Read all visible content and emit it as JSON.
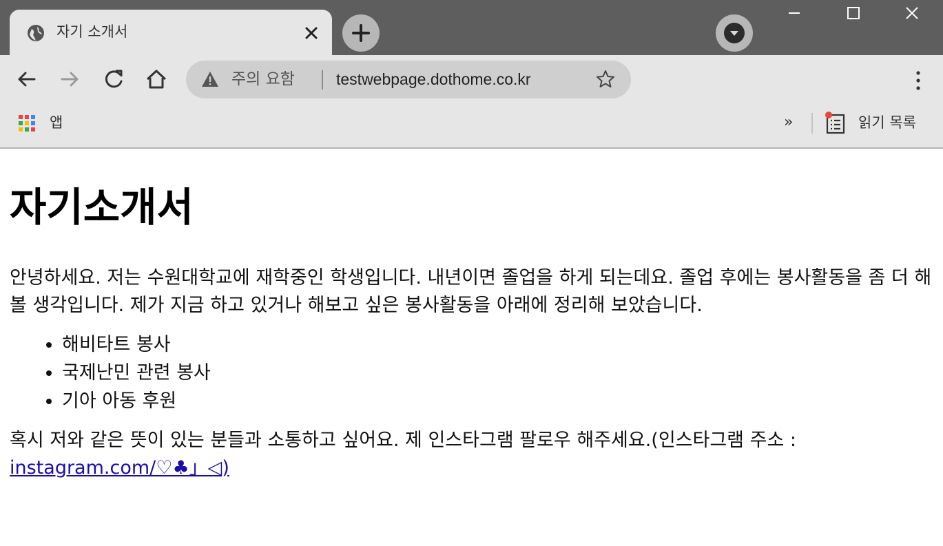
{
  "browser": {
    "tab": {
      "title": "자기 소개서",
      "icon": "globe-icon"
    },
    "omnibox": {
      "security_label": "주의 요함",
      "url": "testwebpage.dothome.co.kr"
    },
    "bookmarks": {
      "apps_label": "앱",
      "overflow_label": "»",
      "reading_list_label": "읽기 목록"
    }
  },
  "page": {
    "heading": "자기소개서",
    "intro": "안녕하세요. 저는 수원대학교에 재학중인 학생입니다. 내년이면 졸업을 하게 되는데요. 졸업 후에는 봉사활동을 좀 더 해볼 생각입니다. 제가 지금 하고 있거나 해보고 싶은 봉사활동을 아래에 정리해 보았습니다.",
    "activities": [
      "해비타트 봉사",
      "국제난민 관련 봉사",
      "기아 아동 후원"
    ],
    "closing": "혹시 저와 같은 뜻이 있는 분들과 소통하고 싶어요. 제 인스타그램 팔로우 해주세요.(인스타그램 주소 : ",
    "link_text": "instagram.com/♡♣」◁)"
  },
  "colors": {
    "titlebar": "#5e5e5e",
    "toolbar": "#e6e6e6",
    "omnibox": "#cfcfcf",
    "link": "#1a0dab"
  }
}
